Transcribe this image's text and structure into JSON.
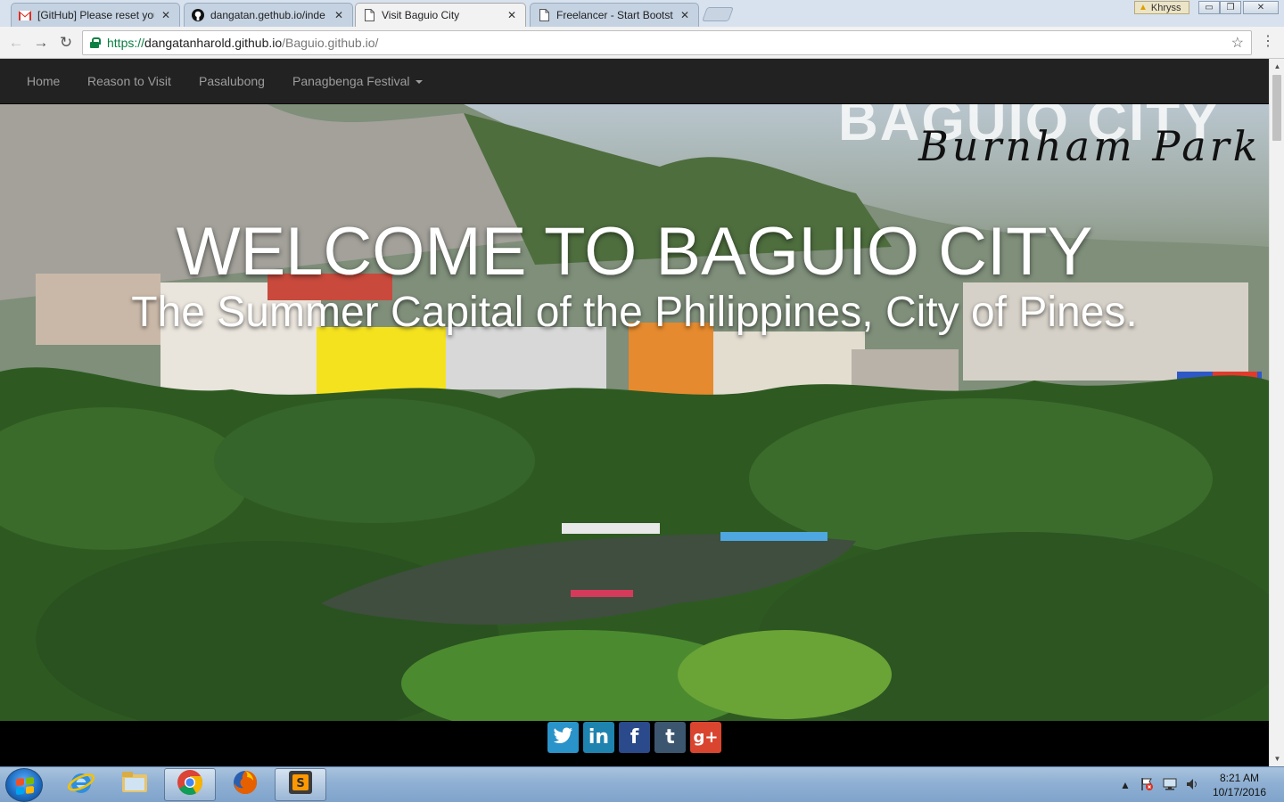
{
  "browser": {
    "tabs": [
      {
        "title": "[GitHub] Please reset your",
        "icon": "gmail-icon",
        "active": false
      },
      {
        "title": "dangatan.gethub.io/inde",
        "icon": "github-icon",
        "active": false
      },
      {
        "title": "Visit Baguio City",
        "icon": "page-icon",
        "active": true
      },
      {
        "title": "Freelancer - Start Bootstr",
        "icon": "page-icon",
        "active": false
      }
    ],
    "profile_name": "Khryss",
    "url": {
      "scheme": "https://",
      "host": "dangatanharold.github.io",
      "path": "/Baguio.github.io/"
    }
  },
  "site": {
    "nav": {
      "home": "Home",
      "reason": "Reason to Visit",
      "pasalubong": "Pasalubong",
      "festival": "Panagbenga Festival"
    },
    "hero": {
      "overlay_title": "BAGUIO CITY",
      "script_text": "Burnham Park",
      "headline": "WELCOME TO BAGUIO CITY",
      "subheadline": "The Summer Capital of the Philippines, City of Pines."
    },
    "social": [
      {
        "name": "twitter",
        "glyph": "🐦",
        "color": "#2a93c9"
      },
      {
        "name": "linkedin",
        "glyph": "in",
        "color": "#1f83b0"
      },
      {
        "name": "facebook",
        "glyph": "f",
        "color": "#2b4a8b"
      },
      {
        "name": "tumblr",
        "glyph": "t",
        "color": "#3d5670"
      },
      {
        "name": "google-plus",
        "glyph": "g+",
        "color": "#d9452f"
      }
    ]
  },
  "taskbar": {
    "apps": [
      "internet-explorer",
      "file-explorer",
      "chrome",
      "firefox",
      "sublime-text"
    ],
    "time": "8:21 AM",
    "date": "10/17/2016"
  }
}
